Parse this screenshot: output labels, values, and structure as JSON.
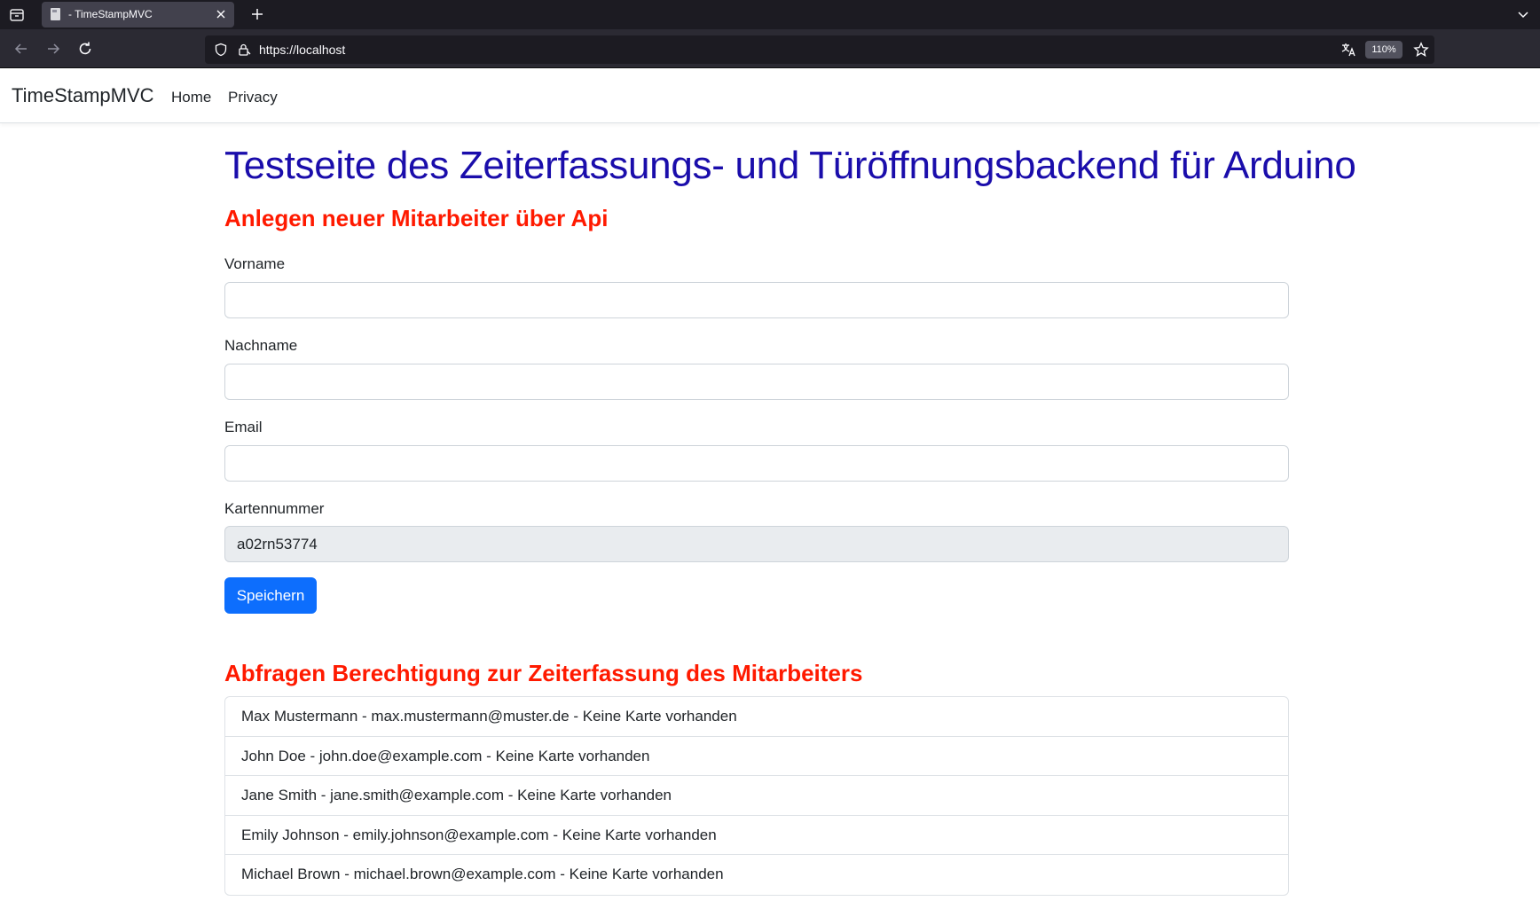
{
  "browser": {
    "tab_title": "- TimeStampMVC",
    "url": "https://localhost",
    "zoom": "110%"
  },
  "site": {
    "brand": "TimeStampMVC",
    "nav": [
      "Home",
      "Privacy"
    ]
  },
  "page": {
    "title": "Testseite des Zeiterfassungs- und Türöffnungsbackend für Arduino",
    "create_section": {
      "heading": "Anlegen neuer Mitarbeiter über Api",
      "fields": [
        {
          "label": "Vorname",
          "value": ""
        },
        {
          "label": "Nachname",
          "value": ""
        },
        {
          "label": "Email",
          "value": ""
        },
        {
          "label": "Kartennummer",
          "value": "a02rn53774",
          "readonly": true
        }
      ],
      "save_label": "Speichern"
    },
    "query_section": {
      "heading": "Abfragen Berechtigung zur Zeiterfassung des Mitarbeiters",
      "employees": [
        "Max Mustermann - max.mustermann@muster.de - Keine Karte vorhanden",
        "John Doe - john.doe@example.com - Keine Karte vorhanden",
        "Jane Smith - jane.smith@example.com - Keine Karte vorhanden",
        "Emily Johnson - emily.johnson@example.com - Keine Karte vorhanden",
        "Michael Brown - michael.brown@example.com - Keine Karte vorhanden"
      ]
    }
  },
  "colors": {
    "title": "#1a0dab",
    "section_heading": "#ff1a00",
    "primary_button": "#0d6efd"
  }
}
